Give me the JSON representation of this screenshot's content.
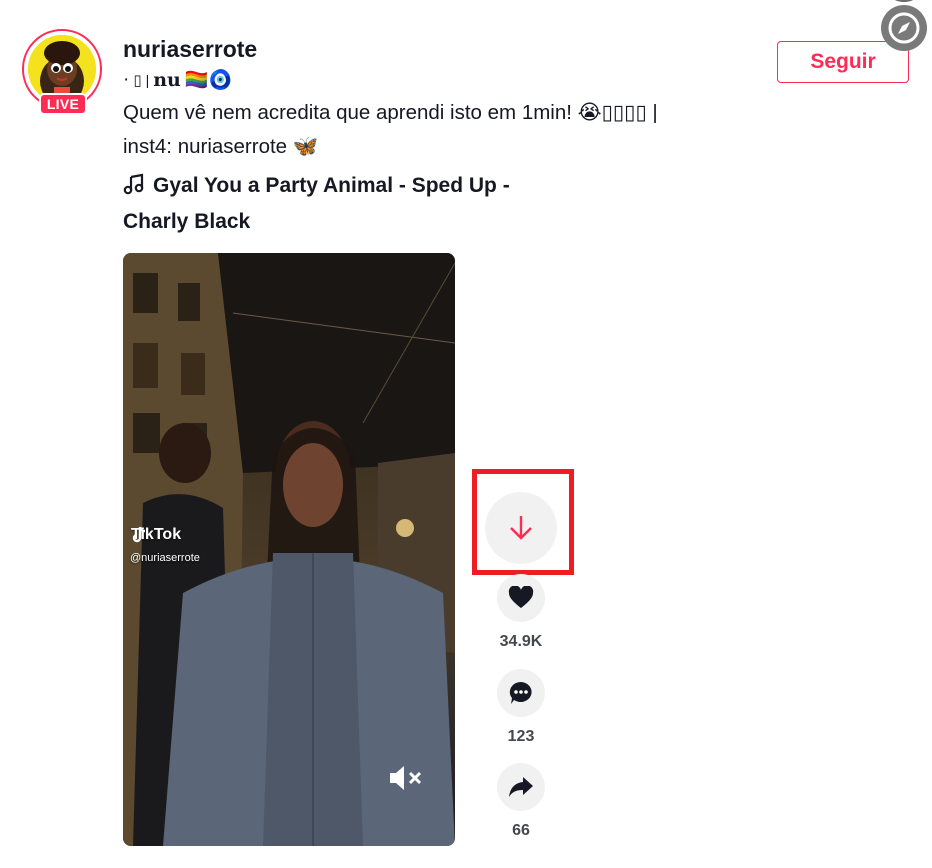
{
  "author": {
    "username": "nuriaserrote",
    "nickname_prefix": "· ",
    "nickname_glyph": "▯",
    "nickname_sep": "|",
    "nickname_text": "nu",
    "nickname_emoji": "🏳️‍🌈🧿",
    "live_label": "LIVE"
  },
  "follow_label": "Seguir",
  "description": {
    "line1": "Quem vê nem acredita que aprendi isto em 1min! 😭▯▯▯▯ |",
    "line2": "inst4: nuriaserrote 🦋"
  },
  "music": {
    "title": "Gyal You a Party Animal - Sped Up - Charly Black"
  },
  "video": {
    "watermark": "TikTok",
    "handle": "@nuriaserrote"
  },
  "actions": {
    "likes": "34.9K",
    "comments": "123",
    "shares": "66"
  },
  "colors": {
    "accent": "#fe2c55",
    "highlight": "#ee1d23"
  }
}
